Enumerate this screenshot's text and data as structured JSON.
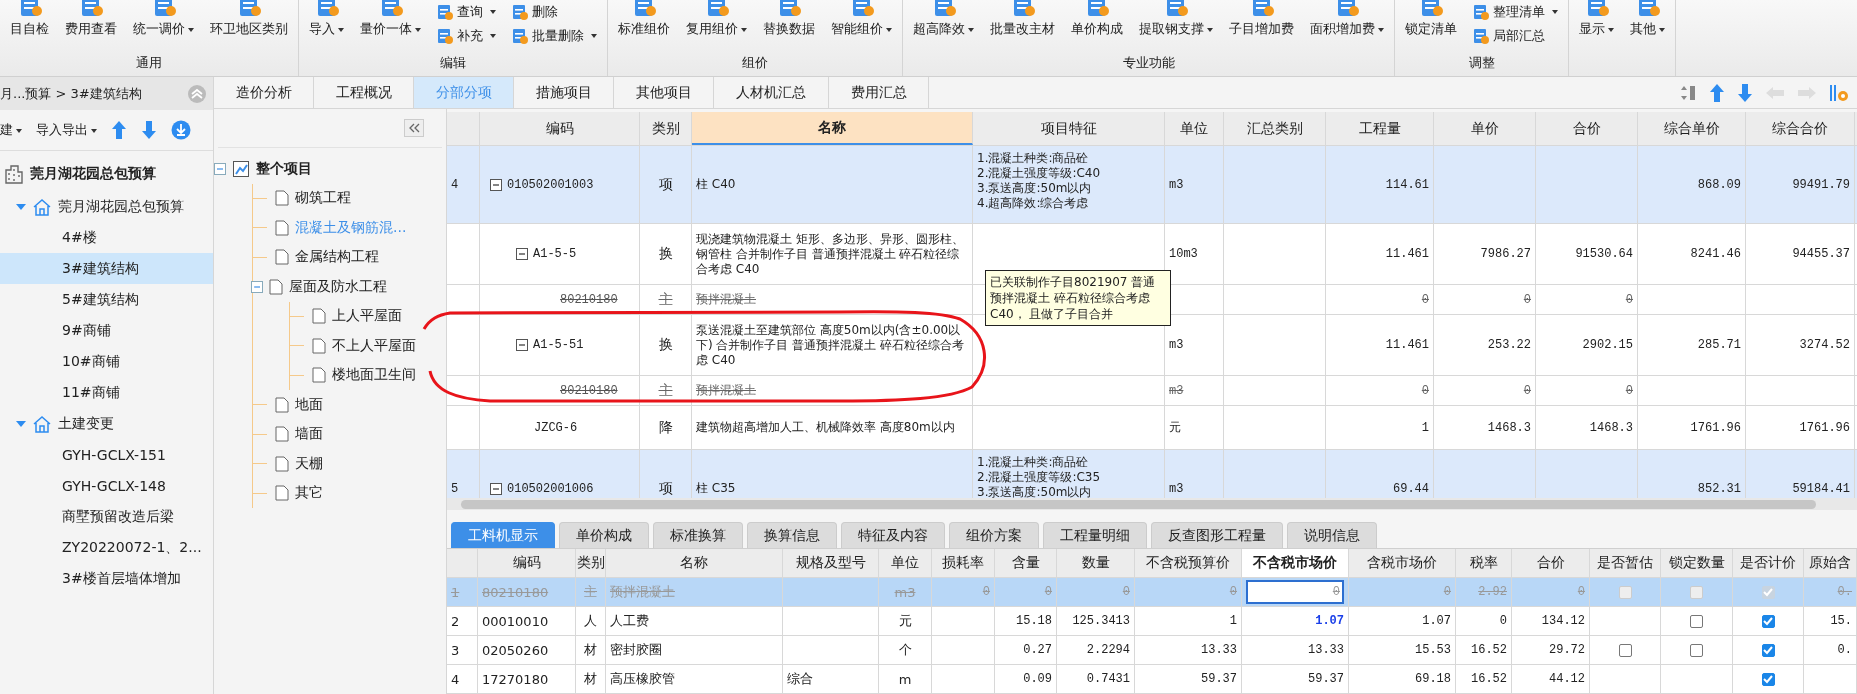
{
  "ribbon": {
    "groups": [
      {
        "label": "通用",
        "items": [
          {
            "kind": "large",
            "label": "目自检",
            "dropdown": false
          },
          {
            "kind": "large",
            "label": "费用查看",
            "dropdown": false
          },
          {
            "kind": "large",
            "label": "统一调价",
            "dropdown": true
          },
          {
            "kind": "large",
            "label": "环卫地区类别",
            "dropdown": false
          }
        ]
      },
      {
        "label": "编辑",
        "items": [
          {
            "kind": "large",
            "label": "导入",
            "dropdown": true
          },
          {
            "kind": "large",
            "label": "量价一体",
            "dropdown": true
          },
          {
            "kind": "stack",
            "items": [
              {
                "label": "查询",
                "dropdown": true
              },
              {
                "label": "补充",
                "dropdown": true
              }
            ]
          },
          {
            "kind": "stack",
            "items": [
              {
                "label": "删除",
                "dropdown": false
              },
              {
                "label": "批量删除",
                "dropdown": true
              }
            ]
          }
        ]
      },
      {
        "label": "组价",
        "items": [
          {
            "kind": "large",
            "label": "标准组价",
            "dropdown": false
          },
          {
            "kind": "large",
            "label": "复用组价",
            "dropdown": true
          },
          {
            "kind": "large",
            "label": "替换数据",
            "dropdown": false
          },
          {
            "kind": "large",
            "label": "智能组价",
            "dropdown": true
          }
        ]
      },
      {
        "label": "专业功能",
        "items": [
          {
            "kind": "large",
            "label": "超高降效",
            "dropdown": true
          },
          {
            "kind": "large",
            "label": "批量改主材",
            "dropdown": false
          },
          {
            "kind": "large",
            "label": "单价构成",
            "dropdown": false
          },
          {
            "kind": "large",
            "label": "提取钢支撑",
            "dropdown": true
          },
          {
            "kind": "large",
            "label": "子目增加费",
            "dropdown": false
          },
          {
            "kind": "large",
            "label": "面积增加费",
            "dropdown": true
          }
        ]
      },
      {
        "label": "调整",
        "items": [
          {
            "kind": "large",
            "label": "锁定清单",
            "dropdown": false
          },
          {
            "kind": "stack",
            "items": [
              {
                "label": "整理清单",
                "dropdown": true
              },
              {
                "label": "局部汇总",
                "dropdown": false
              }
            ]
          }
        ]
      },
      {
        "items": [
          {
            "kind": "large",
            "label": "显示",
            "dropdown": true
          },
          {
            "kind": "large",
            "label": "其他",
            "dropdown": true
          }
        ]
      }
    ]
  },
  "nav": {
    "breadcrumb": "月...预算 > 3#建筑结构",
    "toolbar": [
      {
        "label": "建",
        "dropdown": true
      },
      {
        "label": "导入导出",
        "dropdown": true
      }
    ],
    "tree": [
      {
        "label": "莞月湖花园总包预算",
        "kind": "project",
        "children": [
          {
            "label": "莞月湖花园总包预算",
            "kind": "unit",
            "expanded": true,
            "children": [
              {
                "label": "4#楼",
                "selected": false
              },
              {
                "label": "3#建筑结构",
                "selected": true
              },
              {
                "label": "5#建筑结构",
                "selected": false
              },
              {
                "label": "9#商铺",
                "selected": false
              },
              {
                "label": "10#商铺",
                "selected": false
              },
              {
                "label": "11#商铺",
                "selected": false
              }
            ]
          },
          {
            "label": "土建变更",
            "kind": "unit",
            "expanded": true,
            "children": [
              {
                "label": "GYH-GCLX-151",
                "selected": false
              },
              {
                "label": "GYH-GCLX-148",
                "selected": false
              },
              {
                "label": "商墅预留改造后梁",
                "selected": false
              },
              {
                "label": "ZY20220072-1、2...",
                "selected": false
              },
              {
                "label": "3#楼首层墙体增加",
                "selected": false
              }
            ]
          }
        ]
      }
    ]
  },
  "tabs": [
    {
      "label": "造价分析",
      "selected": false
    },
    {
      "label": "工程概况",
      "selected": false
    },
    {
      "label": "分部分项",
      "selected": true
    },
    {
      "label": "措施项目",
      "selected": false
    },
    {
      "label": "其他项目",
      "selected": false
    },
    {
      "label": "人材机汇总",
      "selected": false
    },
    {
      "label": "费用汇总",
      "selected": false
    }
  ],
  "outline": {
    "tree": [
      {
        "label": "整个项目",
        "kind": "root",
        "expanded": true,
        "selected": false,
        "children": [
          {
            "label": "砌筑工程",
            "selected": false
          },
          {
            "label": "混凝土及钢筋混...",
            "selected": true
          },
          {
            "label": "金属结构工程",
            "selected": false
          },
          {
            "label": "屋面及防水工程",
            "expanded": true,
            "selected": false,
            "children": [
              {
                "label": "上人平屋面",
                "selected": false
              },
              {
                "label": "不上人平屋面",
                "selected": false
              },
              {
                "label": "楼地面卫生间",
                "selected": false
              }
            ]
          },
          {
            "label": "地面",
            "selected": false
          },
          {
            "label": "墙面",
            "selected": false
          },
          {
            "label": "天棚",
            "selected": false
          },
          {
            "label": "其它",
            "selected": false
          }
        ]
      }
    ]
  },
  "grid": {
    "columns": [
      {
        "label": "编码",
        "selected": false
      },
      {
        "label": "类别",
        "selected": false
      },
      {
        "label": "名称",
        "selected": true
      },
      {
        "label": "项目特征",
        "selected": false
      },
      {
        "label": "单位",
        "selected": false
      },
      {
        "label": "汇总类别",
        "selected": false
      },
      {
        "label": "工程量",
        "selected": false
      },
      {
        "label": "单价",
        "selected": false
      },
      {
        "label": "合价",
        "selected": false
      },
      {
        "label": "综合单价",
        "selected": false
      },
      {
        "label": "综合合价",
        "selected": false
      }
    ],
    "rows": [
      {
        "index": "4",
        "kind": "list",
        "code": "010502001003",
        "expanded": true,
        "type": "项",
        "name": "柱 C40",
        "features": [
          "1.混凝土种类:商品砼",
          "2.混凝土强度等级:C40",
          "3.泵送高度:50m以内",
          "4.超高降效:综合考虑"
        ],
        "unit": "m3",
        "quantity": "114.61",
        "composite_price": "868.09",
        "composite_total": "99491.79",
        "children": [
          {
            "kind": "quota",
            "code": "A1-5-5",
            "expanded": true,
            "type": "换",
            "name": "现浇建筑物混凝土 矩形、多边形、异形、圆形柱、钢管柱  合并制作子目 普通预拌混凝土 碎石粒径综合考虑 C40",
            "unit": "10m3",
            "quantity": "11.461",
            "price": "7986.27",
            "total": "91530.64",
            "composite_price": "8241.46",
            "composite_total": "94455.37",
            "children": [
              {
                "kind": "material",
                "code": "80210180",
                "type": "主",
                "name": "预拌混凝土",
                "quantity": "0",
                "price": "0",
                "total": "0"
              }
            ]
          },
          {
            "kind": "quota",
            "code": "A1-5-51",
            "expanded": true,
            "type": "换",
            "name": "泵送混凝土至建筑部位 高度50m以内(含±0.00以下)  合并制作子目 普通预拌混凝土 碎石粒径综合考虑 C40",
            "unit": "m3",
            "quantity": "11.461",
            "price": "253.22",
            "total": "2902.15",
            "composite_price": "285.71",
            "composite_total": "3274.52",
            "children": [
              {
                "kind": "material",
                "code": "80210180",
                "type": "主",
                "name": "预拌混凝土",
                "unit": "m3",
                "quantity": "0",
                "price": "0",
                "total": "0"
              }
            ]
          },
          {
            "kind": "quota",
            "code": "JZCG-6",
            "type": "降",
            "name": "建筑物超高增加人工、机械降效率 高度80m以内",
            "unit": "元",
            "quantity": "1",
            "price": "1468.3",
            "total": "1468.3",
            "composite_price": "1761.96",
            "composite_total": "1761.96"
          }
        ]
      },
      {
        "index": "5",
        "kind": "list",
        "code": "010502001006",
        "expanded": true,
        "type": "项",
        "name": "柱 C35",
        "features": [
          "1.混凝土种类:商品砼",
          "2.混凝土强度等级:C35",
          "3.泵送高度:50m以内"
        ],
        "unit": "m3",
        "quantity": "69.44",
        "composite_price": "852.31",
        "composite_total": "59184.41"
      }
    ]
  },
  "tooltip": {
    "text": "已关联制作子目8021907 普通预拌混凝土 碎石粒径综合考虑 C40， 且做了子目合并"
  },
  "detail": {
    "tabs": [
      {
        "label": "工料机显示",
        "selected": true
      },
      {
        "label": "单价构成",
        "selected": false
      },
      {
        "label": "标准换算",
        "selected": false
      },
      {
        "label": "换算信息",
        "selected": false
      },
      {
        "label": "特征及内容",
        "selected": false
      },
      {
        "label": "组价方案",
        "selected": false
      },
      {
        "label": "工程量明细",
        "selected": false
      },
      {
        "label": "反查图形工程量",
        "selected": false
      },
      {
        "label": "说明信息",
        "selected": false
      }
    ],
    "columns": [
      {
        "label": "编码",
        "selected": false
      },
      {
        "label": "类别",
        "selected": false
      },
      {
        "label": "名称",
        "selected": false
      },
      {
        "label": "规格及型号",
        "selected": false
      },
      {
        "label": "单位",
        "selected": false
      },
      {
        "label": "损耗率",
        "selected": false
      },
      {
        "label": "含量",
        "selected": false
      },
      {
        "label": "数量",
        "selected": false
      },
      {
        "label": "不含税预算价",
        "selected": false
      },
      {
        "label": "不含税市场价",
        "selected": true
      },
      {
        "label": "含税市场价",
        "selected": false
      },
      {
        "label": "税率",
        "selected": false
      },
      {
        "label": "合价",
        "selected": false
      },
      {
        "label": "是否暂估",
        "selected": false
      },
      {
        "label": "锁定数量",
        "selected": false
      },
      {
        "label": "是否计价",
        "selected": false
      },
      {
        "label": "原始含",
        "selected": false
      }
    ],
    "rows": [
      {
        "index": "1",
        "selected": true,
        "struck": true,
        "changed": false,
        "code": "80210180",
        "type": "主",
        "name": "预拌混凝土",
        "unit": "m3",
        "loss": "0",
        "content": "0",
        "quantity": "0",
        "budget_price": "0",
        "market_price": "0",
        "tax_market_price": "0",
        "tax_rate": "2.92",
        "total": "0",
        "estimate": false,
        "lock": false,
        "priced": true,
        "original": "0."
      },
      {
        "index": "2",
        "selected": false,
        "struck": false,
        "changed": true,
        "code": "00010010",
        "type": "人",
        "name": "人工费",
        "unit": "元",
        "content": "15.18",
        "quantity": "125.3413",
        "budget_price": "1",
        "market_price": "1.07",
        "tax_market_price": "1.07",
        "tax_rate": "0",
        "total": "134.12",
        "lock": false,
        "priced": true,
        "original": "15."
      },
      {
        "index": "3",
        "selected": false,
        "struck": false,
        "changed": false,
        "code": "02050260",
        "type": "材",
        "name": "密封胶圈",
        "unit": "个",
        "content": "0.27",
        "quantity": "2.2294",
        "budget_price": "13.33",
        "market_price": "13.33",
        "tax_market_price": "15.53",
        "tax_rate": "16.52",
        "total": "29.72",
        "estimate": false,
        "lock": false,
        "priced": true,
        "original": "0."
      },
      {
        "index": "4",
        "selected": false,
        "struck": false,
        "changed": false,
        "code": "17270180",
        "type": "材",
        "name": "高压橡胶管",
        "spec": "综合",
        "unit": "m",
        "content": "0.09",
        "quantity": "0.7431",
        "budget_price": "59.37",
        "market_price": "59.37",
        "tax_market_price": "69.18",
        "tax_rate": "16.52",
        "total": "44.12",
        "priced": true
      }
    ]
  }
}
